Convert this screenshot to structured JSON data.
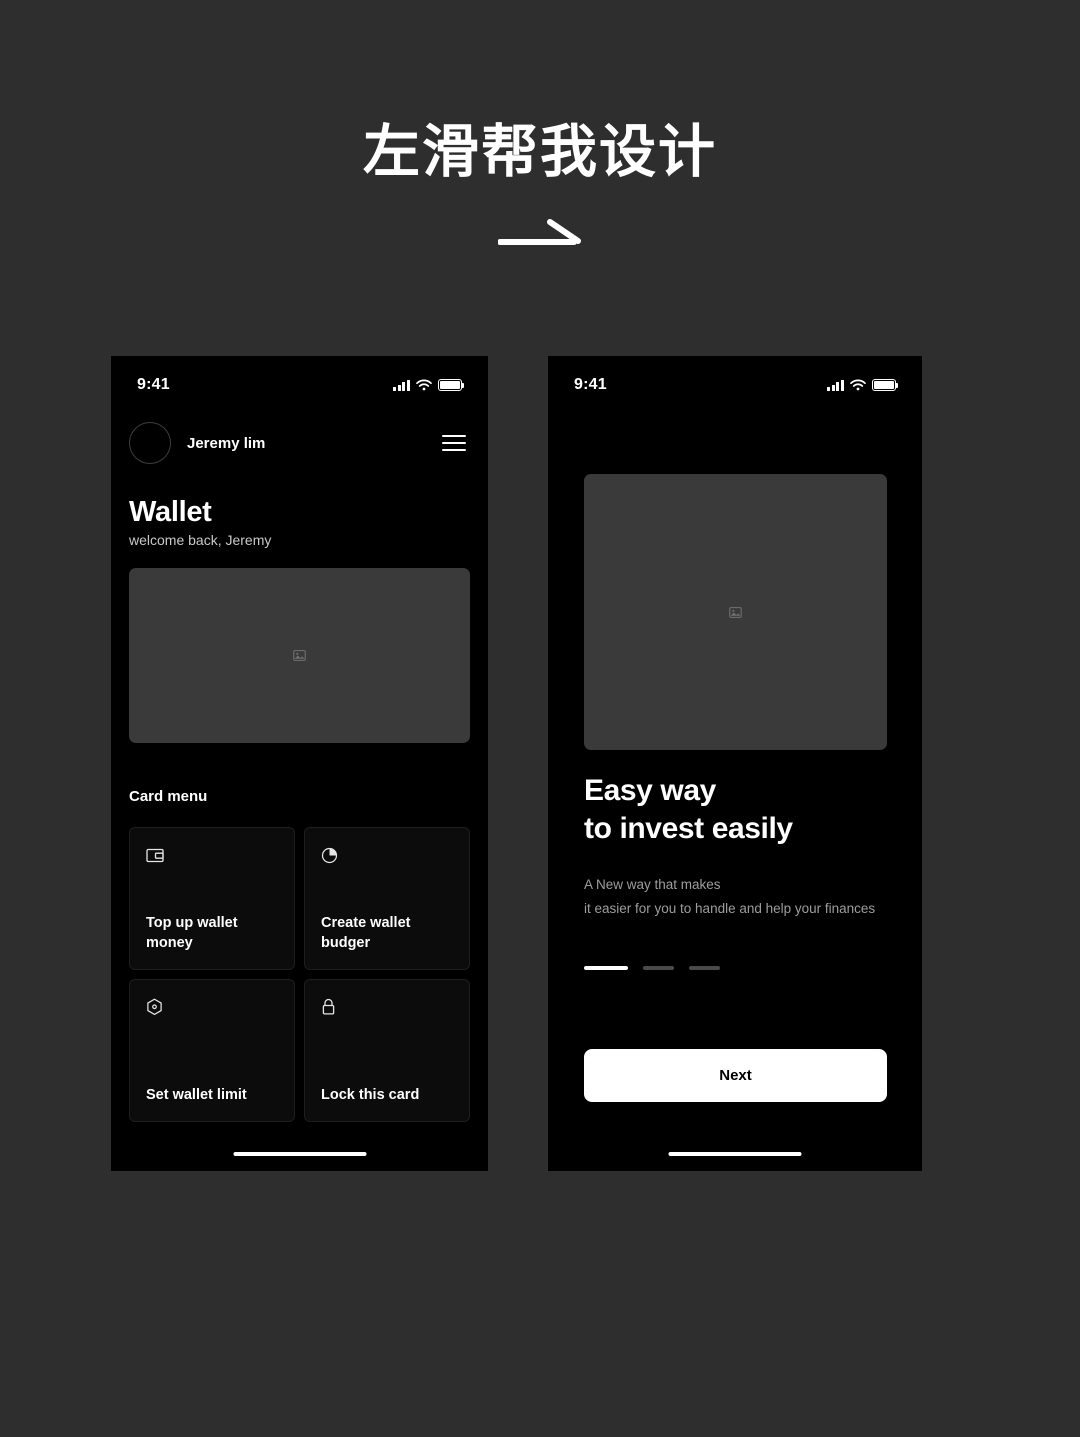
{
  "header": {
    "headline": "左滑帮我设计",
    "arrow_icon": "arrow-right-icon"
  },
  "phone_left": {
    "status_bar": {
      "time": "9:41",
      "signal_icon": "cellular-signal-icon",
      "wifi_icon": "wifi-icon",
      "battery_icon": "battery-full-icon"
    },
    "profile": {
      "avatar_icon": "avatar",
      "name": "Jeremy lim",
      "menu_icon": "hamburger-menu-icon"
    },
    "title": "Wallet",
    "subtitle": "welcome back, Jeremy",
    "hero_image": {
      "placeholder_icon": "broken-image-icon",
      "bg_color": "#3a3a3a"
    },
    "card_menu": {
      "section_label": "Card menu",
      "items": [
        {
          "icon": "wallet-icon",
          "label": "Top up wallet money"
        },
        {
          "icon": "pie-chart-icon",
          "label": "Create wallet budger"
        },
        {
          "icon": "hexagon-settings-icon",
          "label": "Set wallet limit"
        },
        {
          "icon": "lock-icon",
          "label": "Lock this card"
        }
      ]
    },
    "home_indicator": "home-indicator"
  },
  "phone_right": {
    "status_bar": {
      "time": "9:41",
      "signal_icon": "cellular-signal-icon",
      "wifi_icon": "wifi-icon",
      "battery_icon": "battery-full-icon"
    },
    "hero_image": {
      "placeholder_icon": "broken-image-icon",
      "bg_color": "#3a3a3a"
    },
    "title_line1": "Easy way",
    "title_line2": "to invest easily",
    "subtitle_line1": "A New way that makes",
    "subtitle_line2": "it easier for you to handle and help your finances",
    "pagination": {
      "total": 3,
      "active_index": 0,
      "active_color": "#ffffff",
      "inactive_color": "#4a4a4a"
    },
    "next_button": "Next",
    "home_indicator": "home-indicator"
  },
  "theme": {
    "page_bg": "#2e2e2e",
    "screen_bg": "#000000",
    "accent": "#ffffff",
    "card_bg": "#0c0c0c",
    "placeholder_bg": "#3a3a3a"
  }
}
